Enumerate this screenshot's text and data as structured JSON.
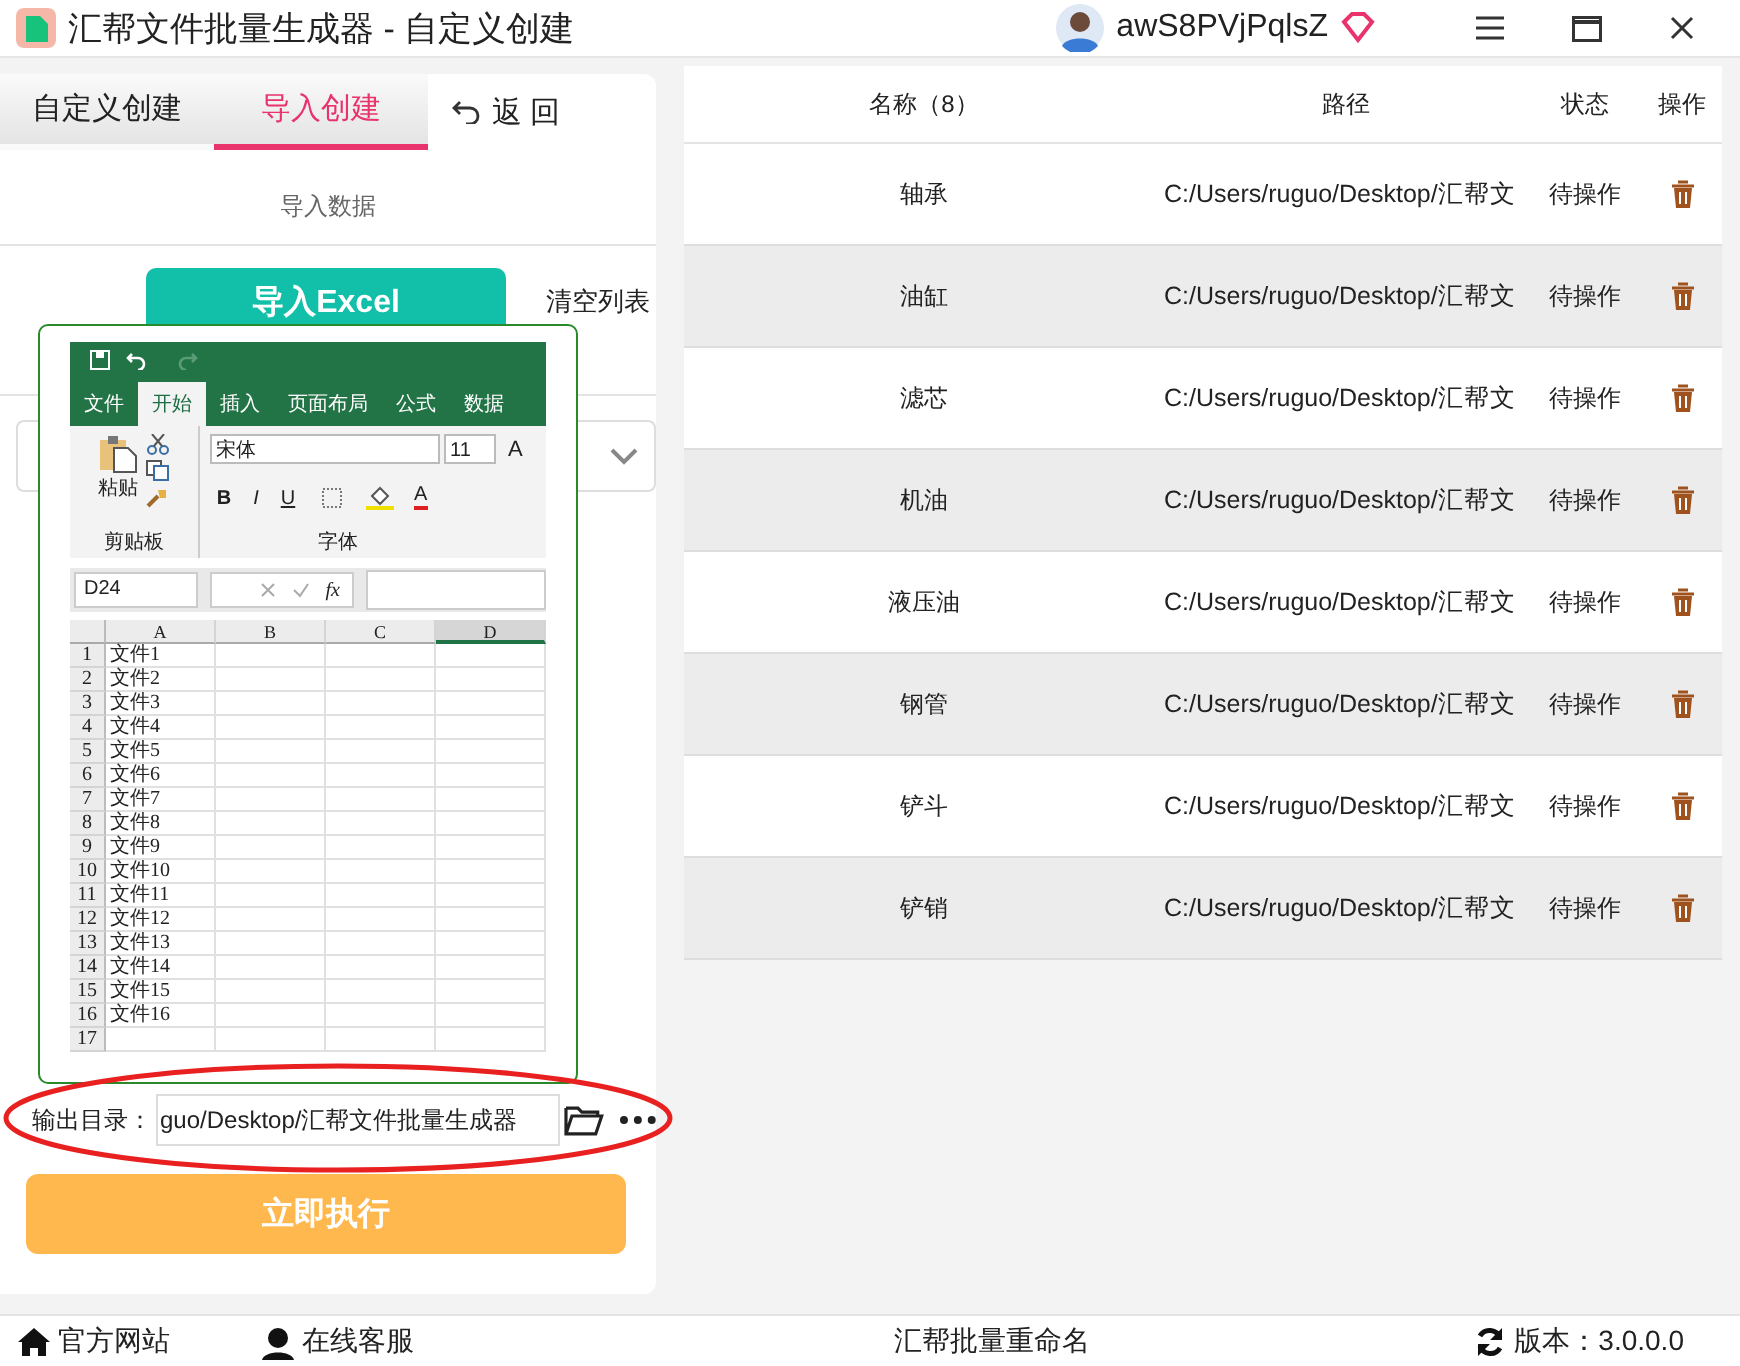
{
  "window": {
    "title": "汇帮文件批量生成器 - 自定义创建",
    "username": "awS8PVjPqlsZ"
  },
  "left_panel": {
    "tabs": [
      {
        "label": "自定义创建",
        "selected": false
      },
      {
        "label": "导入创建",
        "selected": true
      }
    ],
    "back_button": "返 回",
    "section_title": "导入数据",
    "import_button": "导入Excel",
    "clear_button": "清空列表",
    "output": {
      "label": "输出目录：",
      "value": "guo/Desktop/汇帮文件批量生成器"
    },
    "execute_button": "立即执行"
  },
  "excel_preview": {
    "tabs": [
      {
        "label": "文件",
        "selected": false
      },
      {
        "label": "开始",
        "selected": true
      },
      {
        "label": "插入",
        "selected": false
      },
      {
        "label": "页面布局",
        "selected": false
      },
      {
        "label": "公式",
        "selected": false
      },
      {
        "label": "数据",
        "selected": false
      }
    ],
    "paste_label": "粘贴",
    "font_name": "宋体",
    "font_size": "11",
    "format_buttons": [
      "B",
      "I",
      "U"
    ],
    "font_color_button": "A",
    "grow_font_button": "A",
    "group_labels": [
      "剪贴板",
      "字体"
    ],
    "name_box": "D24",
    "formula_label": "fx",
    "columns": [
      {
        "label": "A",
        "selected": false
      },
      {
        "label": "B",
        "selected": false
      },
      {
        "label": "C",
        "selected": false
      },
      {
        "label": "D",
        "selected": true
      }
    ],
    "rows": [
      {
        "number": "1",
        "value": "文件1"
      },
      {
        "number": "2",
        "value": "文件2"
      },
      {
        "number": "3",
        "value": "文件3"
      },
      {
        "number": "4",
        "value": "文件4"
      },
      {
        "number": "5",
        "value": "文件5"
      },
      {
        "number": "6",
        "value": "文件6"
      },
      {
        "number": "7",
        "value": "文件7"
      },
      {
        "number": "8",
        "value": "文件8"
      },
      {
        "number": "9",
        "value": "文件9"
      },
      {
        "number": "10",
        "value": "文件10"
      },
      {
        "number": "11",
        "value": "文件11"
      },
      {
        "number": "12",
        "value": "文件12"
      },
      {
        "number": "13",
        "value": "文件13"
      },
      {
        "number": "14",
        "value": "文件14"
      },
      {
        "number": "15",
        "value": "文件15"
      },
      {
        "number": "16",
        "value": "文件16"
      },
      {
        "number": "17"
      }
    ]
  },
  "table": {
    "columns": [
      "名称（8）",
      "路径",
      "状态",
      "操作"
    ],
    "rows": [
      {
        "name": "轴承",
        "path": "C:/Users/ruguo/Desktop/汇帮文",
        "status": "待操作"
      },
      {
        "name": "油缸",
        "path": "C:/Users/ruguo/Desktop/汇帮文",
        "status": "待操作"
      },
      {
        "name": "滤芯",
        "path": "C:/Users/ruguo/Desktop/汇帮文",
        "status": "待操作"
      },
      {
        "name": "机油",
        "path": "C:/Users/ruguo/Desktop/汇帮文",
        "status": "待操作"
      },
      {
        "name": "液压油",
        "path": "C:/Users/ruguo/Desktop/汇帮文",
        "status": "待操作"
      },
      {
        "name": "钢管",
        "path": "C:/Users/ruguo/Desktop/汇帮文",
        "status": "待操作"
      },
      {
        "name": "铲斗",
        "path": "C:/Users/ruguo/Desktop/汇帮文",
        "status": "待操作"
      },
      {
        "name": "铲销",
        "path": "C:/Users/ruguo/Desktop/汇帮文",
        "status": "待操作"
      }
    ]
  },
  "footer": {
    "links": [
      "官方网站",
      "在线客服"
    ],
    "center": "汇帮批量重命名",
    "version": "版本：3.0.0.0"
  }
}
